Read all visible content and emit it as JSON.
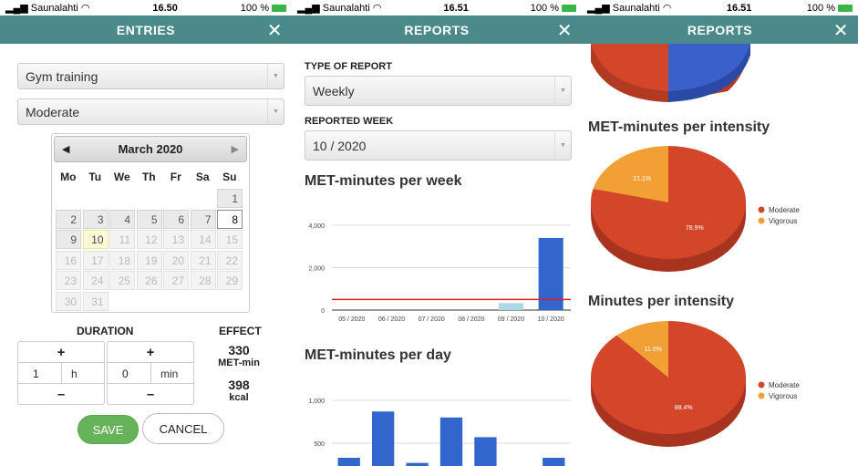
{
  "screen1": {
    "status": {
      "carrier": "Saunalahti",
      "time": "16.50",
      "battery": "100 %"
    },
    "header": {
      "title": "ENTRIES",
      "close": "✕"
    },
    "activity": "Gym training",
    "intensity": "Moderate",
    "calendar": {
      "title": "March 2020",
      "weekdays": [
        "Mo",
        "Tu",
        "We",
        "Th",
        "Fr",
        "Sa",
        "Su"
      ],
      "selected_day": "8",
      "today": "10"
    },
    "duration": {
      "label": "DURATION",
      "plus": "+",
      "minus": "–",
      "hours": "1",
      "hours_unit": "h",
      "minutes": "0",
      "minutes_unit": "min"
    },
    "effect": {
      "label": "EFFECT",
      "met_value": "330",
      "met_unit": "MET-min",
      "kcal_value": "398",
      "kcal_unit": "kcal"
    },
    "save": "SAVE",
    "cancel": "CANCEL"
  },
  "screen2": {
    "status": {
      "carrier": "Saunalahti",
      "time": "16.51",
      "battery": "100 %"
    },
    "header": {
      "title": "REPORTS",
      "close": "✕"
    },
    "type_label": "TYPE OF REPORT",
    "type_value": "Weekly",
    "week_label": "REPORTED WEEK",
    "week_value": "10 / 2020",
    "chart1_title": "MET-minutes per week",
    "chart2_title": "MET-minutes per day"
  },
  "screen3": {
    "status": {
      "carrier": "Saunalahti",
      "time": "16.51",
      "battery": "100 %"
    },
    "header": {
      "title": "REPORTS",
      "close": "✕"
    },
    "pie1_title": "MET-minutes per intensity",
    "pie2_title": "Minutes per intensity"
  },
  "chart_data": [
    {
      "type": "bar",
      "title": "MET-minutes per week",
      "categories": [
        "05 / 2020",
        "06 / 2020",
        "07 / 2020",
        "08 / 2020",
        "09 / 2020",
        "10 / 2020"
      ],
      "values": [
        0,
        0,
        0,
        0,
        330,
        3400
      ],
      "bar_colors": [
        "#3366cc",
        "#3366cc",
        "#3366cc",
        "#3366cc",
        "#add8e6",
        "#3366cc"
      ],
      "yticks": [
        "0",
        "2,000",
        "4,000"
      ],
      "ylim": [
        0,
        4000
      ],
      "reference_line": 500,
      "reference_color": "#dd2222"
    },
    {
      "type": "bar",
      "title": "MET-minutes per day",
      "values": [
        330,
        870,
        270,
        800,
        570,
        0,
        330
      ],
      "yticks": [
        "500",
        "1,000"
      ],
      "ylim": [
        0,
        1000
      ],
      "bar_color": "#3366cc"
    },
    {
      "type": "pie",
      "title": "MET-minutes per intensity",
      "labels": [
        "Moderate",
        "Vigorous"
      ],
      "values": [
        78.9,
        21.1
      ],
      "value_labels": [
        "78.9%",
        "21.1%"
      ],
      "colors": [
        "#d4462a",
        "#f0a035"
      ]
    },
    {
      "type": "pie",
      "title": "Minutes per intensity",
      "labels": [
        "Moderate",
        "Vigorous"
      ],
      "values": [
        88.4,
        11.6
      ],
      "value_labels": [
        "88.4%",
        "11.6%"
      ],
      "colors": [
        "#d4462a",
        "#f0a035"
      ]
    }
  ]
}
